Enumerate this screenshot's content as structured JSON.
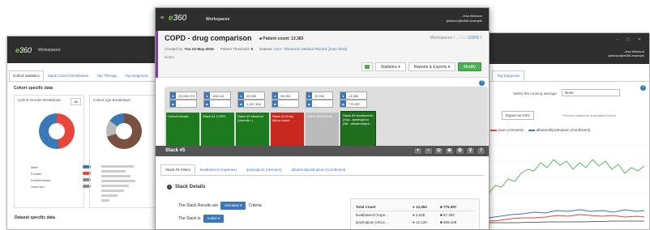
{
  "brand": {
    "logo_e": "e",
    "logo_rest": "360"
  },
  "left_window": {
    "workspace": "Workspaces",
    "tabs": [
      "Cohort Statistics",
      "Stack Control Distribution",
      "Top Therapy",
      "Top Diagnosis"
    ],
    "section_title": "Cohort specific data",
    "gender_title": "Cohort Gender Breakdown",
    "age_title": "Cohort Age Breakdown",
    "select_value": "All",
    "gender_legend": [
      {
        "label": "Male",
        "color": "#3a78b8"
      },
      {
        "label": "Female",
        "color": "#e8453c"
      },
      {
        "label": "Indeterminate",
        "color": "#888888"
      },
      {
        "label": "Unknown",
        "color": "#888888"
      }
    ],
    "dataset_title": "Dataset specific data"
  },
  "right_window": {
    "user_name": "Jess Wickson",
    "user_email": "jwickson@e360.example",
    "tab": "Top Diagnosis",
    "avg_label": "Select the running average",
    "avg_value": "None",
    "export_label": "Export as CSV",
    "note": "* Percent related to final patient count",
    "legend": [
      {
        "label": "pium (Atrovent)",
        "color": "#e8453c"
      },
      {
        "label": "albuterol/ipratropium (Combivent)",
        "color": "#3a78b8"
      }
    ]
  },
  "main": {
    "workspace": "Workspaces",
    "user_name": "Jess Wickson",
    "user_email": "jwickson@e360.example",
    "title": "COPD - drug comparison",
    "patient_count": "Patient count: 13,383",
    "breadcrumb_prefix": "Workspaces  /  ...  /",
    "breadcrumb_current": "COPD /",
    "created_by_label": "Created by:",
    "created_by": "You",
    "created_on": "02-May-2016",
    "threshold_label": "Patient Threshold:",
    "threshold": "8",
    "dataset_label": "Dataset:",
    "dataset": "USA - Electronic Medical Record (June 2016)",
    "notes_label": "Notes:",
    "btn_statistics": "Statistics ▾",
    "btn_reports": "Reports & Exports ▾",
    "btn_modify": "Modify",
    "counters": [
      {
        "a": "20,000,073",
        "b": "..."
      },
      {
        "a": "108,144",
        "b": "..."
      },
      {
        "a": "35,093",
        "b": "1,207,393"
      },
      {
        "a": "39,094",
        "b": "..."
      },
      {
        "a": "20,094",
        "b": "..."
      },
      {
        "a": "13,383",
        "b": "775,397"
      }
    ],
    "stacks": [
      {
        "label": "Cohort Details",
        "color": "#1e7a1e"
      },
      {
        "label": "Stack #1 COPD",
        "color": "#1e7a1e"
      },
      {
        "label": "Stack #2 albuterol (Ventolin..)",
        "color": "#1e7a1e"
      },
      {
        "label": "Stack #3 Entry Minus Index",
        "color": "#c8281e"
      },
      {
        "label": "Stack #4 Exclude...",
        "color": "#bbbbbb"
      },
      {
        "label": "Stack #5 levalbuterol (Xop.. ipratropium (Atr.. albuterol/ipra..",
        "color": "#1e6e1e"
      }
    ],
    "stack_bar_title": "Stack #5",
    "stack_tools": [
      "+",
      "−",
      "⊙",
      "⊕",
      "⚙",
      "⚲",
      "?"
    ],
    "subtabs": [
      "Stack #5 Filters",
      "levalbuterol (Xopenex)",
      "ipratropium (Atrovent)",
      "albuterol/ipratropium (Combivent)"
    ],
    "details_title": "Stack Details",
    "details_icon": "i",
    "crit1_pre": "The Stack Results are",
    "crit1_val": "Inclusion ▾",
    "crit1_post": "Criteria",
    "crit2_pre": "The Stack is",
    "crit2_val": "Active ▾",
    "count_rows": [
      {
        "n": "Total Count",
        "a": "13,383",
        "b": "775,397"
      },
      {
        "n": "levalbuterol (Xope...",
        "a": "2,635",
        "b": "87,283"
      },
      {
        "n": "ipratropium (Atrov...",
        "a": "12,120",
        "b": "668,109"
      }
    ]
  }
}
